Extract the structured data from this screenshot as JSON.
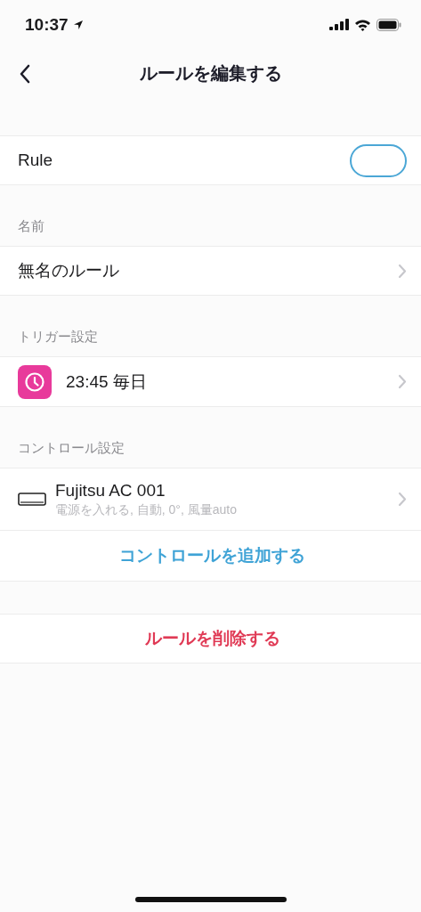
{
  "status_bar": {
    "time": "10:37"
  },
  "nav": {
    "title": "ルールを編集する"
  },
  "rule_toggle": {
    "label": "Rule",
    "on": false
  },
  "sections": [
    {
      "header": "名前",
      "rows": [
        {
          "kind": "name",
          "title": "無名のルール"
        }
      ]
    },
    {
      "header": "トリガー設定",
      "rows": [
        {
          "kind": "trigger",
          "title": "23:45 毎日"
        }
      ]
    },
    {
      "header": "コントロール設定",
      "rows": [
        {
          "kind": "device",
          "title": "Fujitsu AC 001",
          "subtitle": "電源を入れる, 自動, 0°, 風量auto"
        }
      ]
    }
  ],
  "add_control": {
    "label": "コントロールを追加する"
  },
  "delete_rule": {
    "label": "ルールを削除する"
  }
}
